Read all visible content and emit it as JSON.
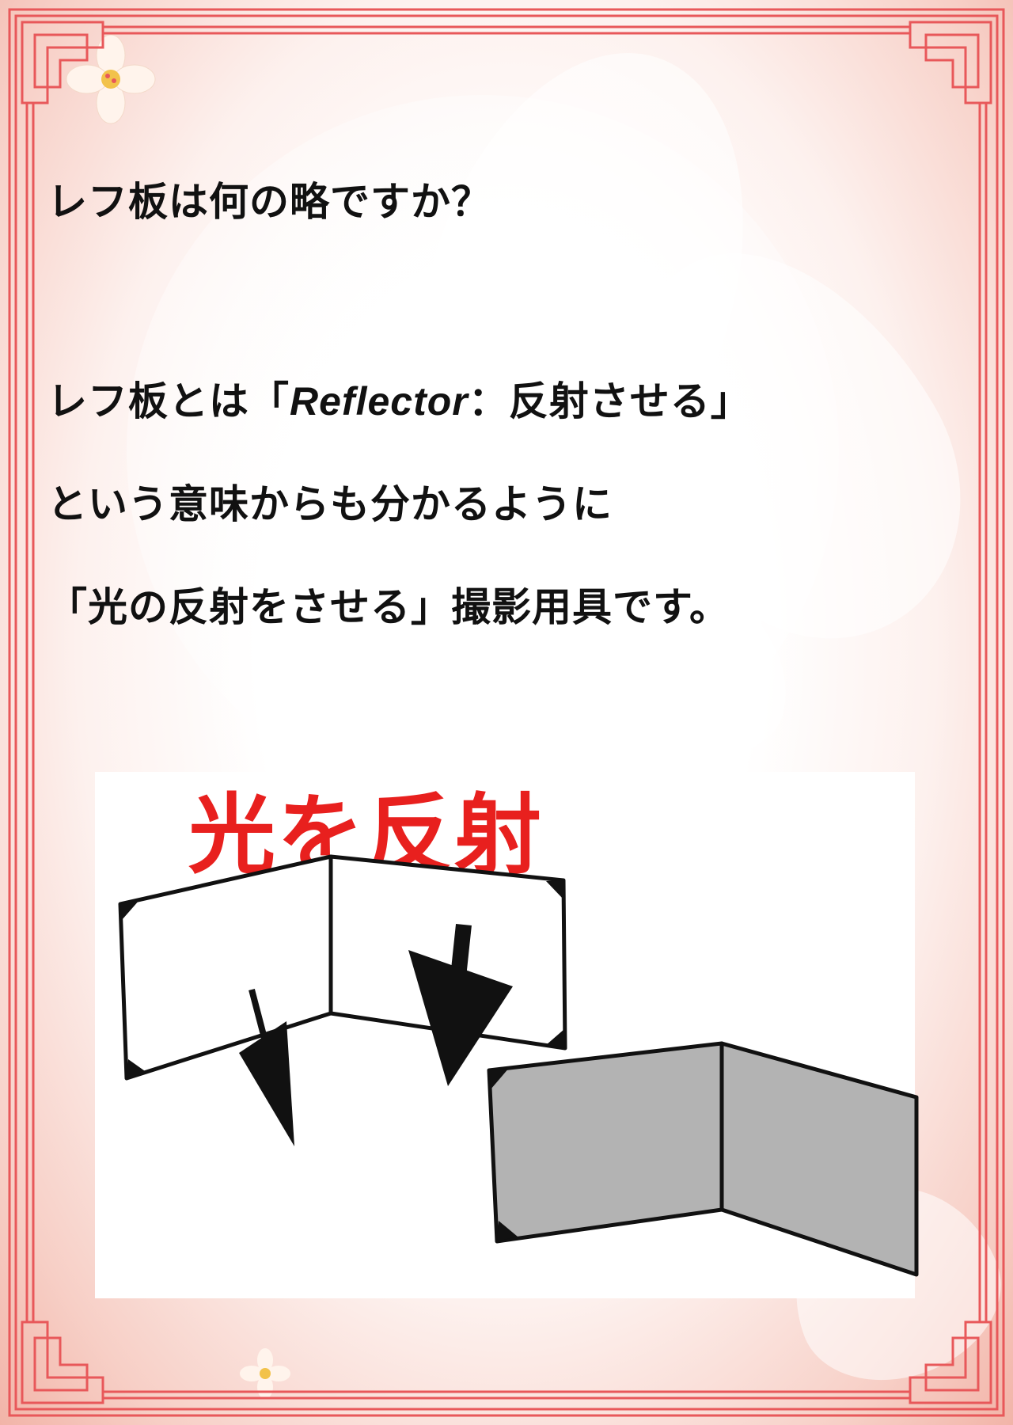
{
  "question": "レフ板は何の略ですか？",
  "answer": {
    "line1_prefix": "レフ板とは「",
    "line1_latin": "Reflector",
    "line1_suffix": "：反射させる」",
    "line2": "という意味からも分かるように",
    "line3": "「光の反射をさせる」撮影用具です。"
  },
  "illustration": {
    "title": "光を反射",
    "icons": [
      "reflector-board-white-icon",
      "reflector-board-gray-icon",
      "arrow-down-icon"
    ]
  },
  "colors": {
    "title_red": "#e8201e",
    "frame_red": "#e8585a",
    "text": "#111111",
    "board_gray": "#b3b3b3"
  }
}
